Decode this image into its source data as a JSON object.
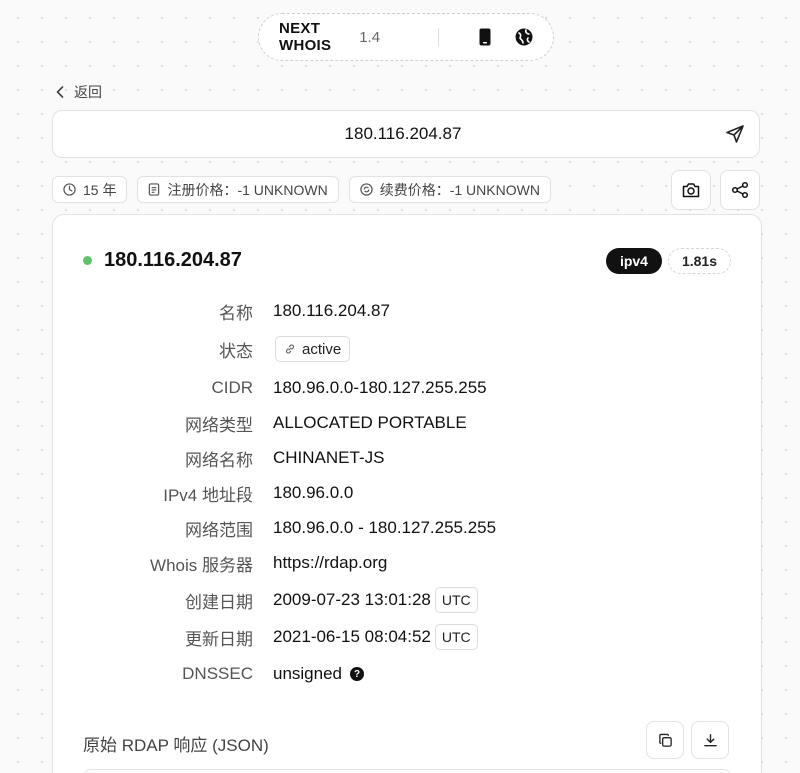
{
  "app": {
    "brand": "NEXT WHOIS",
    "version": "1.4"
  },
  "nav": {
    "back_label": "返回"
  },
  "search": {
    "value": "180.116.204.87"
  },
  "chips": [
    {
      "icon": "clock-icon",
      "text": "15 年"
    },
    {
      "icon": "document-icon",
      "text": "注册价格：-1 UNKNOWN"
    },
    {
      "icon": "renew-icon",
      "text": "续费价格：-1 UNKNOWN"
    }
  ],
  "result": {
    "title": "180.116.204.87",
    "status_color": "#5ec26a",
    "type_tag": "ipv4",
    "time_tag": "1.81s",
    "fields": {
      "name": {
        "label": "名称",
        "value": "180.116.204.87"
      },
      "status": {
        "label": "状态",
        "value": "active"
      },
      "cidr": {
        "label": "CIDR",
        "value": "180.96.0.0-180.127.255.255"
      },
      "net_type": {
        "label": "网络类型",
        "value": "ALLOCATED PORTABLE"
      },
      "net_name": {
        "label": "网络名称",
        "value": "CHINANET-JS"
      },
      "ipv4": {
        "label": "IPv4 地址段",
        "value": "180.96.0.0"
      },
      "range": {
        "label": "网络范围",
        "value": "180.96.0.0 - 180.127.255.255"
      },
      "whois": {
        "label": "Whois 服务器",
        "value": "https://rdap.org"
      },
      "created": {
        "label": "创建日期",
        "value": "2009-07-23 13:01:28",
        "tz": "UTC"
      },
      "updated": {
        "label": "更新日期",
        "value": "2021-06-15 08:04:52",
        "tz": "UTC"
      },
      "dnssec": {
        "label": "DNSSEC",
        "value": "unsigned"
      }
    },
    "raw_title": "原始 RDAP 响应 (JSON)"
  }
}
